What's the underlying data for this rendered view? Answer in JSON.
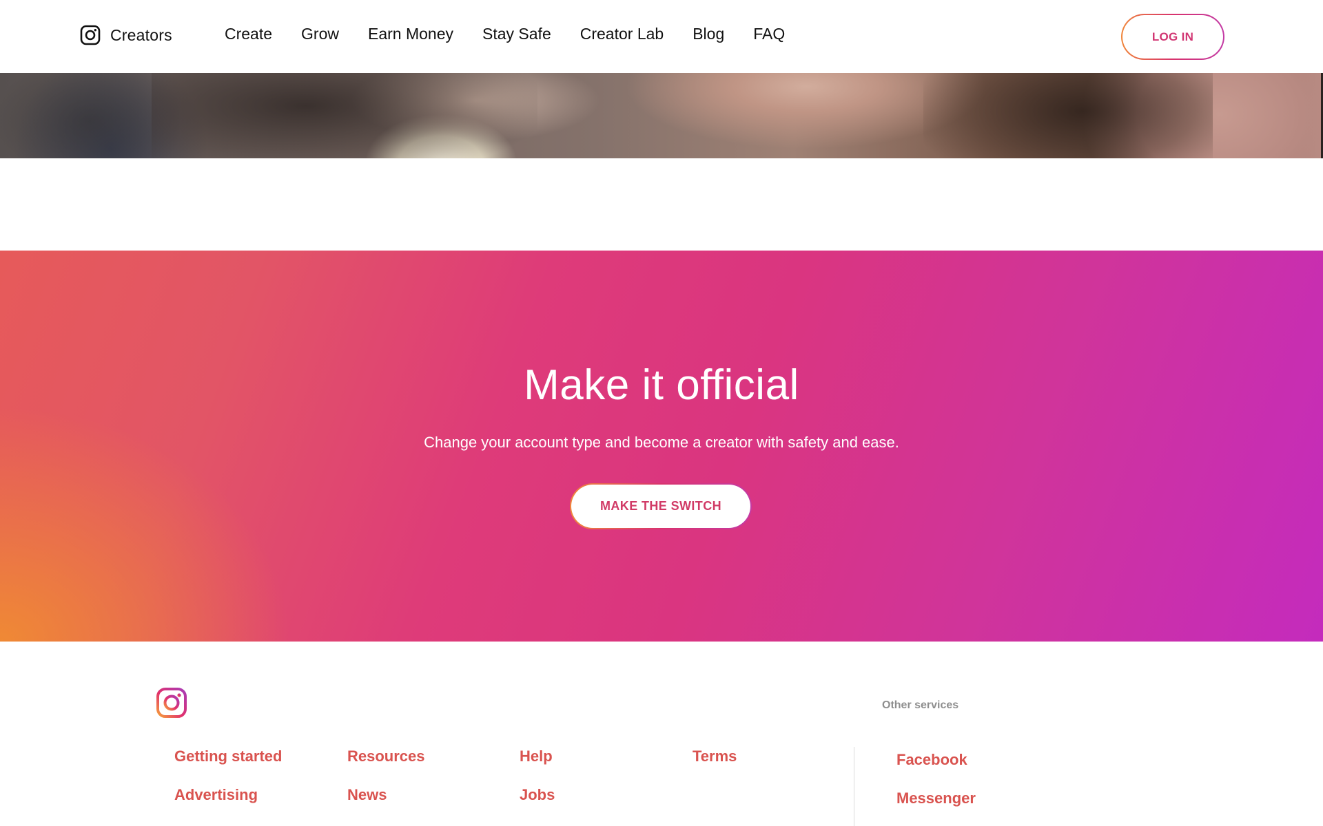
{
  "header": {
    "brand_label": "Creators",
    "nav": [
      {
        "label": "Create"
      },
      {
        "label": "Grow"
      },
      {
        "label": "Earn Money"
      },
      {
        "label": "Stay Safe"
      },
      {
        "label": "Creator Lab"
      },
      {
        "label": "Blog"
      },
      {
        "label": "FAQ"
      }
    ],
    "login_label": "LOG IN"
  },
  "cta": {
    "title": "Make it official",
    "subtitle": "Change your account type and become a creator with safety and ease.",
    "button_label": "MAKE THE SWITCH"
  },
  "footer": {
    "other_services_label": "Other services",
    "columns": [
      {
        "links": [
          "Getting started",
          "Advertising"
        ]
      },
      {
        "links": [
          "Resources",
          "News"
        ]
      },
      {
        "links": [
          "Help",
          "Jobs"
        ]
      },
      {
        "links": [
          "Terms"
        ]
      }
    ],
    "other_services": [
      "Facebook",
      "Messenger"
    ]
  },
  "icons": {
    "brand_icon": "instagram-outline-icon",
    "footer_logo": "instagram-gradient-logo-icon"
  },
  "colors": {
    "accent": "#d13572",
    "footer_link": "#d9534f",
    "gradient_start": "#f0873b",
    "gradient_mid": "#de3b79",
    "gradient_end": "#c42bbd",
    "muted_label": "#8e8e8e"
  }
}
